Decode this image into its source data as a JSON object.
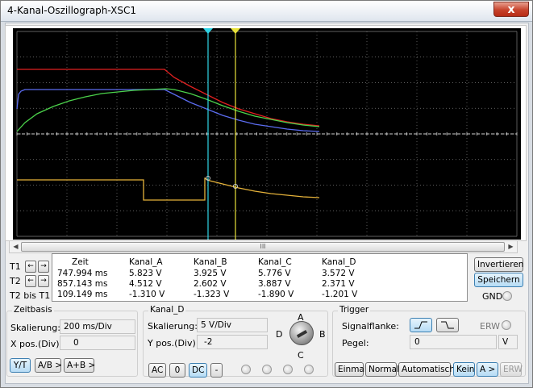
{
  "window": {
    "title": "4-Kanal-Oszillograph-XSC1",
    "close_glyph": "x"
  },
  "scope": {
    "scroll_thumb_glyph": "III"
  },
  "cursors": {
    "t1_label": "T1",
    "t2_label": "T2",
    "diff_label": "T2 bis T1",
    "left_arrow": "←",
    "right_arrow": "→"
  },
  "measurement": {
    "headers": [
      "Zeit",
      "Kanal_A",
      "Kanal_B",
      "Kanal_C",
      "Kanal_D"
    ],
    "rows": [
      [
        "747.994 ms",
        "5.823 V",
        "3.925 V",
        "5.776 V",
        "3.572 V"
      ],
      [
        "857.143 ms",
        "4.512 V",
        "2.602 V",
        "3.887 V",
        "2.371 V"
      ],
      [
        "109.149 ms",
        "-1.310 V",
        "-1.323 V",
        "-1.890 V",
        "-1.201 V"
      ]
    ]
  },
  "side_buttons": {
    "invert": "Invertieren",
    "save": "Speichern",
    "gnd": "GND"
  },
  "timebase": {
    "title": "Zeitbasis",
    "scale_label": "Skalierung:",
    "scale_value": "200 ms/Div",
    "xpos_label": "X pos.(Div):",
    "xpos_value": "0",
    "modes": [
      "Y/T",
      "A/B >",
      "A+B >"
    ]
  },
  "channel": {
    "title": "Kanal_D",
    "scale_label": "Skalierung:",
    "scale_value": "5  V/Div",
    "ypos_label": "Y pos.(Div):",
    "ypos_value": "-2",
    "coupling": [
      "AC",
      "0",
      "DC",
      "-"
    ],
    "knob_labels": [
      "A",
      "B",
      "C",
      "D"
    ]
  },
  "trigger": {
    "title": "Trigger",
    "edge_label": "Signalflanke:",
    "ext_label": "ERW",
    "level_label": "Pegel:",
    "level_value": "0",
    "level_unit": "V",
    "modes": [
      "Einmal",
      "Normal",
      "Automatisch",
      "Kein",
      "A >",
      "ERW"
    ]
  },
  "colors": {
    "screen_bg": "#000000",
    "grid": "#7f7f7f",
    "channel_a": "#e02020",
    "channel_b": "#5b6cf0",
    "channel_c": "#4bd24b",
    "channel_d": "#e5b23a",
    "cursor_t1": "#2fd4e6",
    "cursor_t2": "#e8e23a"
  }
}
